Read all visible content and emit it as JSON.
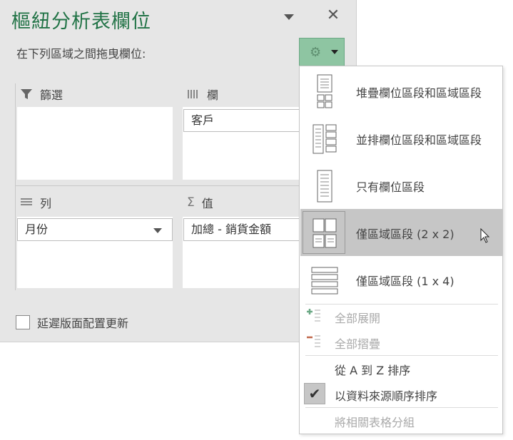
{
  "pane": {
    "title": "樞紐分析表欄位",
    "subtitle": "在下列區域之間拖曳欄位:",
    "close_glyph": "✕",
    "gear_glyph": "⚙",
    "accent_color": "#217346"
  },
  "areas": {
    "filters": {
      "label": "篩選",
      "icon": "filter-icon"
    },
    "columns": {
      "label": "欄",
      "icon": "columns-icon",
      "field": "客戶"
    },
    "rows": {
      "label": "列",
      "icon": "rows-icon",
      "field": "月份"
    },
    "values": {
      "label": "值",
      "icon": "sigma-icon",
      "glyph": "Σ",
      "field": "加總 - 銷貨金額"
    }
  },
  "defer": {
    "label": "延遲版面配置更新",
    "checked": false
  },
  "menu": {
    "layouts": [
      {
        "label": "堆疊欄位區段和區域區段",
        "icon": "stacked-layout-icon",
        "selected": false
      },
      {
        "label": "並排欄位區段和區域區段",
        "icon": "side-by-side-layout-icon",
        "selected": false
      },
      {
        "label": "只有欄位區段",
        "icon": "fields-only-layout-icon",
        "selected": false
      },
      {
        "label": "僅區域區段 (2 x 2)",
        "icon": "areas-2x2-layout-icon",
        "selected": true
      },
      {
        "label": "僅區域區段 (1 x 4)",
        "icon": "areas-1x4-layout-icon",
        "selected": false
      }
    ],
    "expand_all": {
      "label": "全部展開",
      "icon": "expand-all-icon",
      "disabled": true
    },
    "collapse_all": {
      "label": "全部摺疊",
      "icon": "collapse-all-icon",
      "disabled": true
    },
    "sort_az": {
      "label": "從 A 到 Z 排序",
      "checked": false
    },
    "sort_source": {
      "label": "以資料來源順序排序",
      "checked": true,
      "check_glyph": "✔"
    },
    "group_tables": {
      "label": "將相關表格分組",
      "disabled": true
    }
  }
}
